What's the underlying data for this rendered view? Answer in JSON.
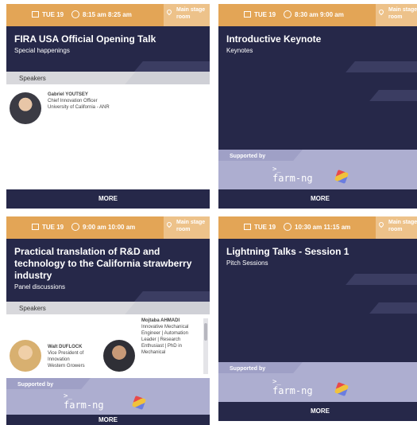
{
  "cards": [
    {
      "day": "TUE 19",
      "time": "8:15 am 8:25 am",
      "stage": "Main stage room",
      "title": "FIRA USA Official Opening Talk",
      "subtitle": "Special happenings",
      "speakers_label": "Speakers",
      "speakers": [
        {
          "name": "Gabriel YOUTSEY",
          "role": "Chief Innovation Officer",
          "org": "University of California - ANR"
        }
      ],
      "more": "MORE"
    },
    {
      "day": "TUE 19",
      "time": "8:30 am 9:00 am",
      "stage": "Main stage room",
      "title": "Introductive Keynote",
      "subtitle": "Keynotes",
      "supported_by": "Supported by",
      "sponsor": "farm-ng",
      "more": "MORE"
    },
    {
      "day": "TUE 19",
      "time": "9:00 am 10:00 am",
      "stage": "Main stage room",
      "title": "Practical translation of R&D and technology to the California strawberry industry",
      "subtitle": "Panel discussions",
      "speakers_label": "Speakers",
      "speakers": [
        {
          "name": "Walt DUFLOCK",
          "role": "Vice President of Innovation",
          "org": "Western Growers"
        },
        {
          "name": "Mojtaba AHMADI",
          "role": "Innovative Mechanical Engineer | Automation Leader | Research Enthusiast | PhD in Mechanical",
          "org": ""
        }
      ],
      "supported_by": "Supported by",
      "sponsor": "farm-ng",
      "more": "MORE"
    },
    {
      "day": "TUE 19",
      "time": "10:30 am 11:15 am",
      "stage": "Main stage room",
      "title": "Lightning Talks - Session 1",
      "subtitle": "Pitch Sessions",
      "supported_by": "Supported by",
      "sponsor": "farm-ng",
      "more": "MORE"
    }
  ],
  "colors": {
    "accent": "#e3a556",
    "header": "#262849",
    "supported": "#adaed0"
  }
}
